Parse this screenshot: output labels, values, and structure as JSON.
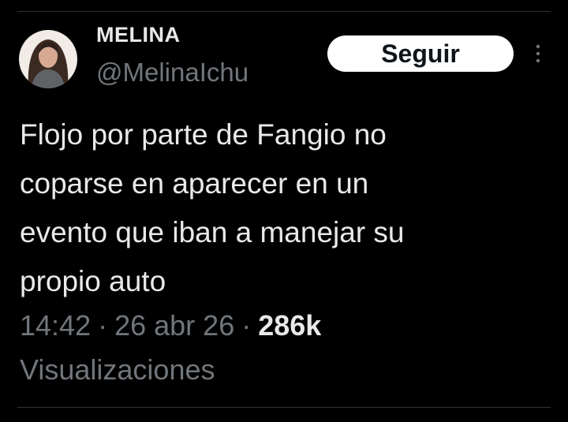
{
  "author": {
    "display_name": "MELINA",
    "handle": "@MelinaIchu",
    "avatar_icon": "profile-photo"
  },
  "follow_button": {
    "label": "Seguir"
  },
  "more_icon": "more-vertical-icon",
  "tweet": {
    "lines": [
      "Flojo por parte de Fangio no",
      "coparse en aparecer en un",
      "evento que iban a manejar su",
      "propio auto"
    ]
  },
  "meta": {
    "time": "14:42",
    "separator": "·",
    "date": "26 abr 26",
    "views_count": "286k",
    "views_label": "Visualizaciones"
  },
  "colors": {
    "background": "#000000",
    "primary_text": "#e7e9ea",
    "secondary_text": "#71767b",
    "button_background": "#ffffff",
    "divider": "#2f3336"
  }
}
